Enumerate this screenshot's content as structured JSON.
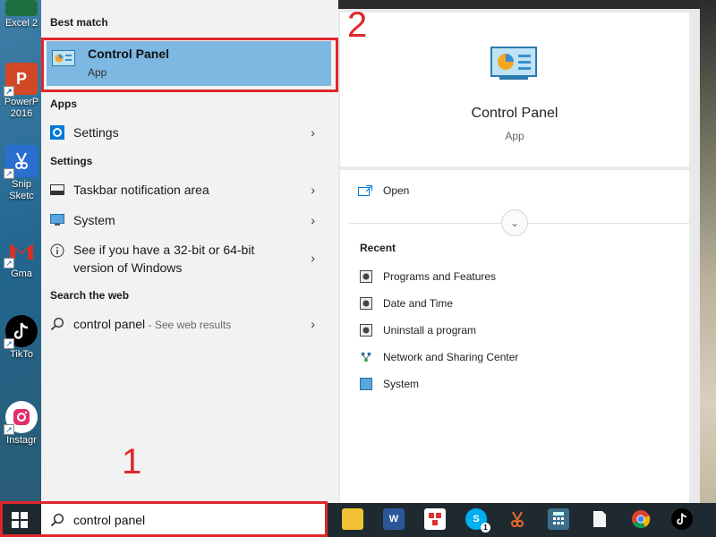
{
  "desktop": {
    "icons": [
      {
        "label": "Excel 2",
        "icon": "excel-icon"
      },
      {
        "label": "PowerP\n2016",
        "icon": "powerpoint-icon"
      },
      {
        "label": "Snip\nSketc",
        "icon": "snip-sketch-icon"
      },
      {
        "label": "Gma",
        "icon": "gmail-icon"
      },
      {
        "label": "TikTo",
        "icon": "tiktok-icon"
      },
      {
        "label": "Instagr",
        "icon": "instagram-icon"
      }
    ]
  },
  "start_menu": {
    "best_match_header": "Best match",
    "best_match": {
      "title": "Control Panel",
      "type": "App",
      "icon": "control-panel-icon"
    },
    "apps_header": "Apps",
    "apps": [
      {
        "label": "Settings",
        "icon": "settings-gear-icon"
      }
    ],
    "settings_header": "Settings",
    "settings": [
      {
        "label": "Taskbar notification area",
        "icon": "taskbar-icon"
      },
      {
        "label": "System",
        "icon": "monitor-icon"
      },
      {
        "label": "See if you have a 32-bit or 64-bit",
        "label2": "version of Windows",
        "icon": "info-icon"
      }
    ],
    "web_header": "Search the web",
    "web": {
      "label": "control panel",
      "suffix": " - See web results",
      "icon": "search-icon"
    }
  },
  "detail": {
    "title": "Control Panel",
    "type": "App",
    "open_label": "Open",
    "recent_header": "Recent",
    "recent": [
      {
        "label": "Programs and Features",
        "icon": "programs-icon"
      },
      {
        "label": "Date and Time",
        "icon": "clock-icon"
      },
      {
        "label": "Uninstall a program",
        "icon": "uninstall-icon"
      },
      {
        "label": "Network and Sharing Center",
        "icon": "network-icon"
      },
      {
        "label": "System",
        "icon": "monitor-icon"
      }
    ]
  },
  "annotations": {
    "step1": "1",
    "step2": "2",
    "color": "#e0262c"
  },
  "taskbar": {
    "search_value": "control panel",
    "apps": [
      "file-explorer-icon",
      "word-icon",
      "snip-icon",
      "skype-icon",
      "snip-sketch-icon",
      "calculator-icon",
      "file-icon",
      "chrome-icon",
      "tiktok-icon"
    ],
    "skype_badge": "1"
  },
  "colors": {
    "highlight": "#7cb8e2",
    "taskbar": "#1f2a30",
    "accent": "#0078d7"
  }
}
